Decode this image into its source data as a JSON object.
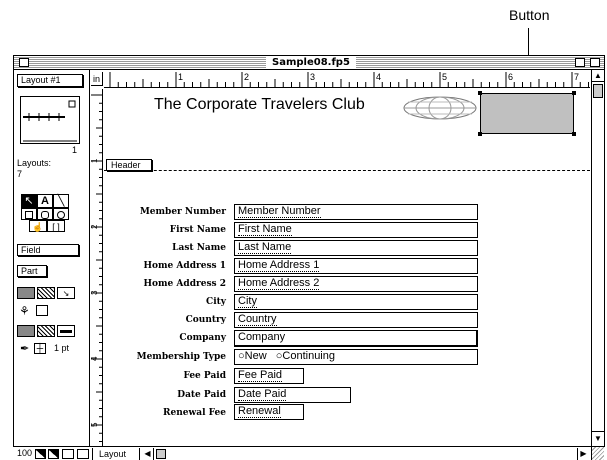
{
  "callout": {
    "label": "Button"
  },
  "window": {
    "title": "Sample08.fp5"
  },
  "status_area": {
    "layout_popup": "Layout #1",
    "layouts_label": "Layouts:",
    "layouts_count": "7",
    "page_number": "1",
    "field_popup": "Field",
    "part_popup": "Part",
    "line_width": "1 pt",
    "zoom": "100",
    "mode": "Layout"
  },
  "ruler": {
    "unit": "in",
    "marks": [
      "1",
      "2",
      "3",
      "4",
      "5",
      "6",
      "7"
    ],
    "vmarks": [
      "1",
      "2",
      "3",
      "4",
      "5"
    ]
  },
  "layout": {
    "heading": "The Corporate Travelers Club",
    "header_part": "Header",
    "fields": [
      {
        "label": "Member Number",
        "value": "Member Number"
      },
      {
        "label": "First Name",
        "value": "First Name"
      },
      {
        "label": "Last Name",
        "value": "Last Name"
      },
      {
        "label": "Home Address 1",
        "value": "Home Address 1"
      },
      {
        "label": "Home Address 2",
        "value": "Home Address 2"
      },
      {
        "label": "City",
        "value": "City"
      },
      {
        "label": "Country",
        "value": "Country"
      },
      {
        "label": "Company",
        "value": "Company"
      },
      {
        "label": "Membership Type",
        "options": [
          "New",
          "Continuing"
        ]
      },
      {
        "label": "Fee Paid",
        "value": "Fee Paid"
      },
      {
        "label": "Date Paid",
        "value": "Date Paid"
      },
      {
        "label": "Renewal Fee",
        "value": "Renewal"
      }
    ]
  },
  "colors": {
    "button_fill": "#c0c0c0",
    "title_stripes": "#9a9a9a"
  }
}
